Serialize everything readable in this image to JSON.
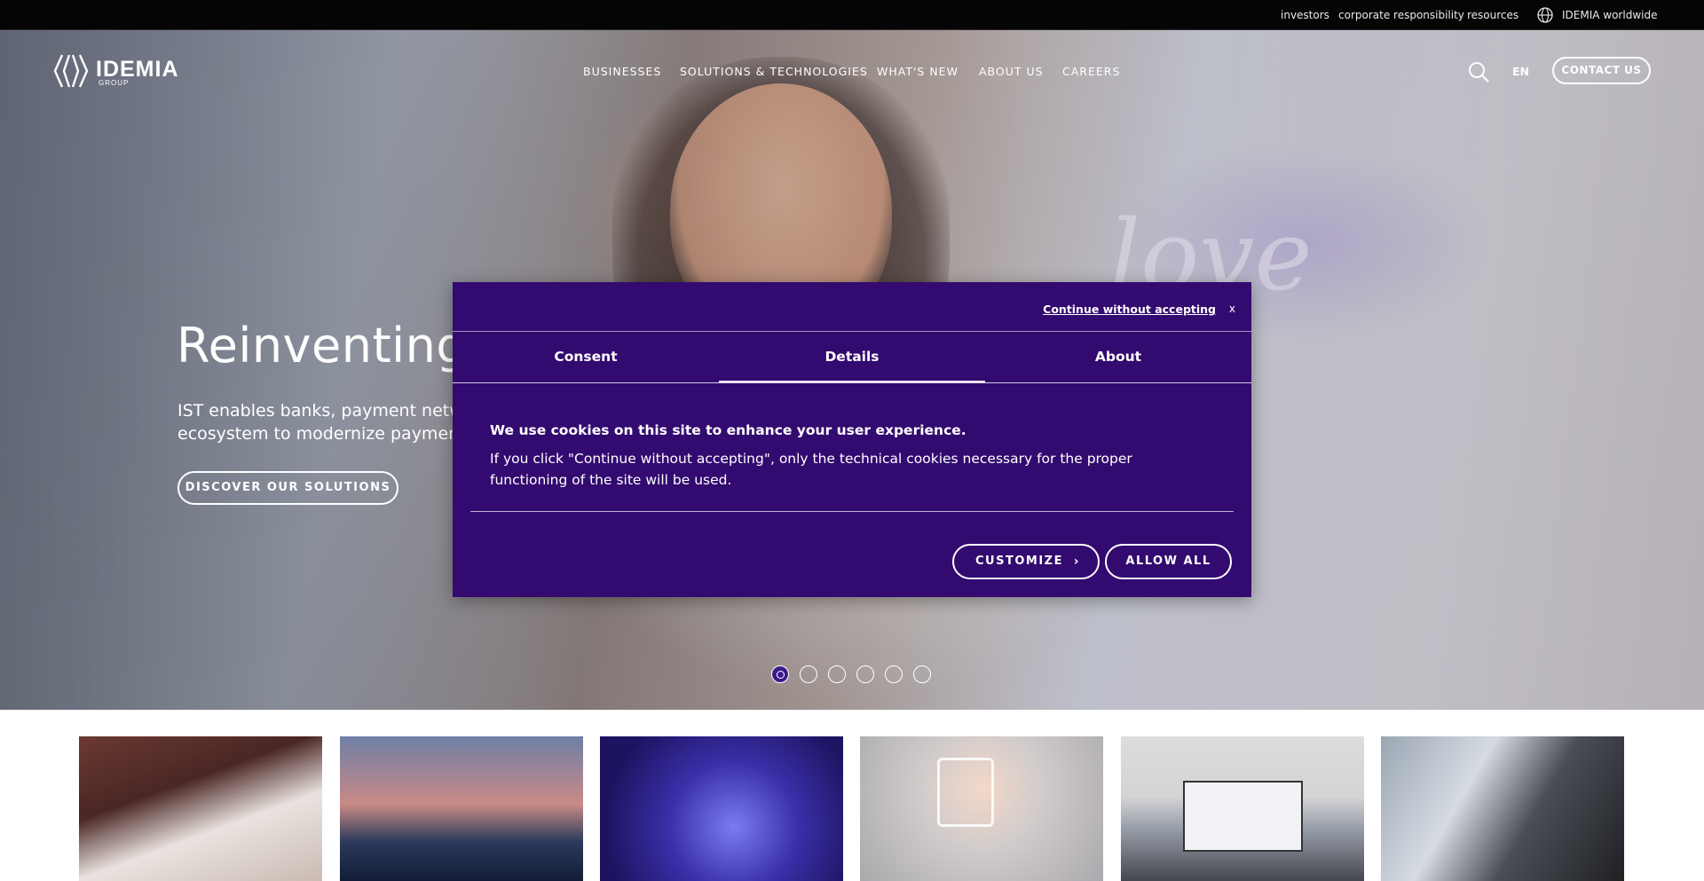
{
  "utility_nav": {
    "investors": "investors",
    "corporate_responsibility": "corporate responsibility",
    "resources": "resources",
    "worldwide": "IDEMIA worldwide"
  },
  "logo": {
    "name": "IDEMIA",
    "sub": "GROUP"
  },
  "main_nav": [
    "BUSINESSES",
    "SOLUTIONS & TECHNOLOGIES",
    "WHAT'S NEW",
    "ABOUT US",
    "CAREERS"
  ],
  "header": {
    "lang": "EN",
    "contact": "CONTACT US"
  },
  "hero": {
    "title": "Reinventing t",
    "subtitle_line1": "IST enables banks, payment netwo",
    "subtitle_line2": "ecosystem to modernize payments",
    "cta": "DISCOVER OUR SOLUTIONS",
    "slides_count": 6,
    "active_slide": 1
  },
  "cookie_modal": {
    "continue_without": "Continue without accepting",
    "close": "x",
    "tabs": [
      "Consent",
      "Details",
      "About"
    ],
    "active_tab": "Details",
    "heading": "We use cookies on this site to enhance your user experience.",
    "body": "If you click \"Continue without accepting\", only the technical cookies necessary for the proper functioning of the site will be used.",
    "customize": "CUSTOMIZE",
    "allow_all": "ALLOW ALL"
  },
  "colors": {
    "modal_bg": "#330a70",
    "topbar_bg": "#050505",
    "active_dot": "#3a1a8a"
  },
  "icons": {
    "search": "search-icon",
    "globe": "globe-icon",
    "chevron": "chevron-right-icon",
    "close": "close-icon"
  }
}
